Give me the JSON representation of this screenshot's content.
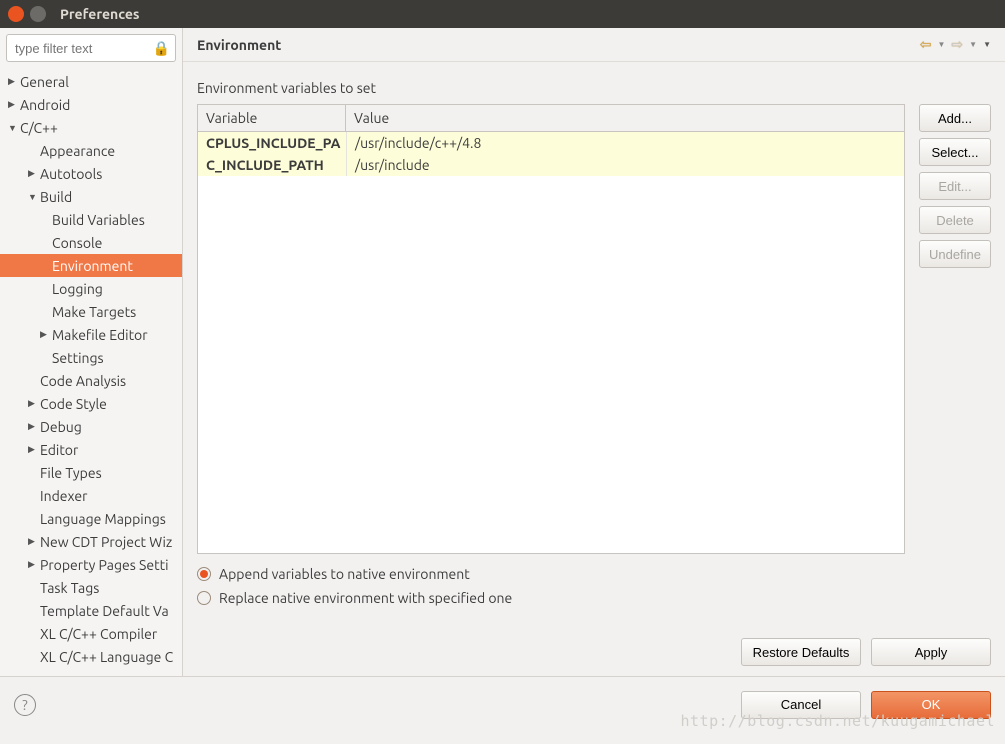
{
  "window": {
    "title": "Preferences"
  },
  "filter": {
    "placeholder": "type filter text"
  },
  "tree": {
    "general": "General",
    "android": "Android",
    "ccpp": "C/C++",
    "appearance": "Appearance",
    "autotools": "Autotools",
    "build": "Build",
    "build_vars": "Build Variables",
    "console": "Console",
    "environment": "Environment",
    "logging": "Logging",
    "make_targets": "Make Targets",
    "makefile_editor": "Makefile Editor",
    "settings": "Settings",
    "code_analysis": "Code Analysis",
    "code_style": "Code Style",
    "debug": "Debug",
    "editor": "Editor",
    "file_types": "File Types",
    "indexer": "Indexer",
    "lang_map": "Language Mappings",
    "new_cdt": "New CDT Project Wiz",
    "prop_pages": "Property Pages Setti",
    "task_tags": "Task Tags",
    "template_def": "Template Default Va",
    "xl_compiler": "XL C/C++ Compiler",
    "xl_lang": "XL C/C++ Language C"
  },
  "main": {
    "title": "Environment",
    "section_label": "Environment variables to set",
    "columns": {
      "variable": "Variable",
      "value": "Value"
    },
    "rows": [
      {
        "variable": "CPLUS_INCLUDE_PA",
        "value": "/usr/include/c++/4.8"
      },
      {
        "variable": "C_INCLUDE_PATH",
        "value": "/usr/include"
      }
    ],
    "buttons": {
      "add": "Add...",
      "select": "Select...",
      "edit": "Edit...",
      "delete": "Delete",
      "undefine": "Undefine",
      "restore": "Restore Defaults",
      "apply": "Apply"
    },
    "radio": {
      "append": "Append variables to native environment",
      "replace": "Replace native environment with specified one"
    }
  },
  "bottom": {
    "cancel": "Cancel",
    "ok": "OK"
  },
  "watermark": "http://blog.csdn.net/kuugamichael"
}
